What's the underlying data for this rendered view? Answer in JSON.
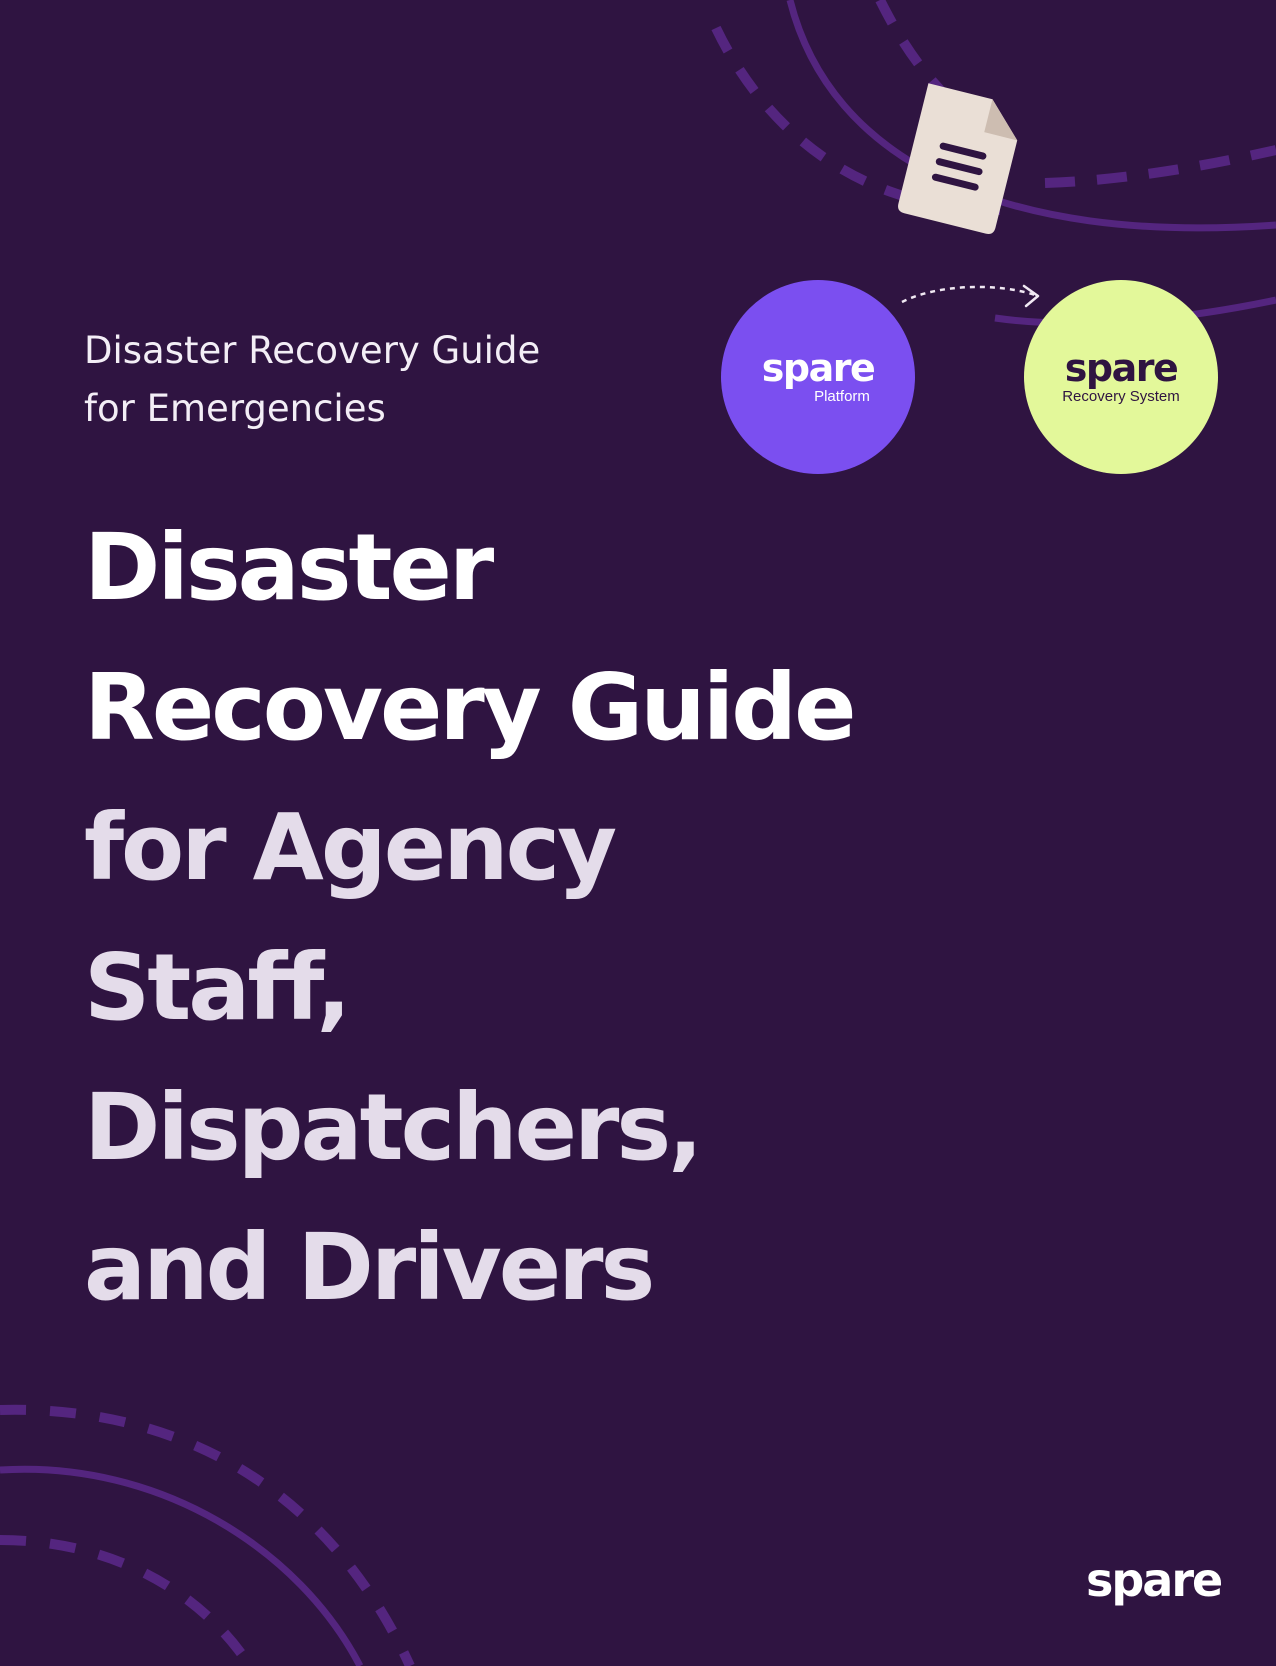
{
  "cover": {
    "subtitle_lines": [
      "Disaster Recovery Guide",
      "for Emergencies"
    ],
    "title_lines": [
      "Disaster",
      "Recovery Guide",
      "for Agency",
      "Staff,",
      "Dispatchers,",
      "and Drivers"
    ]
  },
  "diagram": {
    "source": {
      "brand": "spare",
      "label": "Platform"
    },
    "target": {
      "brand": "spare",
      "label": "Recovery System"
    },
    "document_icon": "document-icon",
    "arrow_icon": "dashed-arrow-icon"
  },
  "footer": {
    "logo_text": "spare"
  },
  "colors": {
    "background": "#2f1441",
    "platform_circle": "#7b4ff0",
    "recovery_circle": "#e3f89a",
    "accent_curve": "#5a2a86",
    "document": "#eadfd6"
  }
}
